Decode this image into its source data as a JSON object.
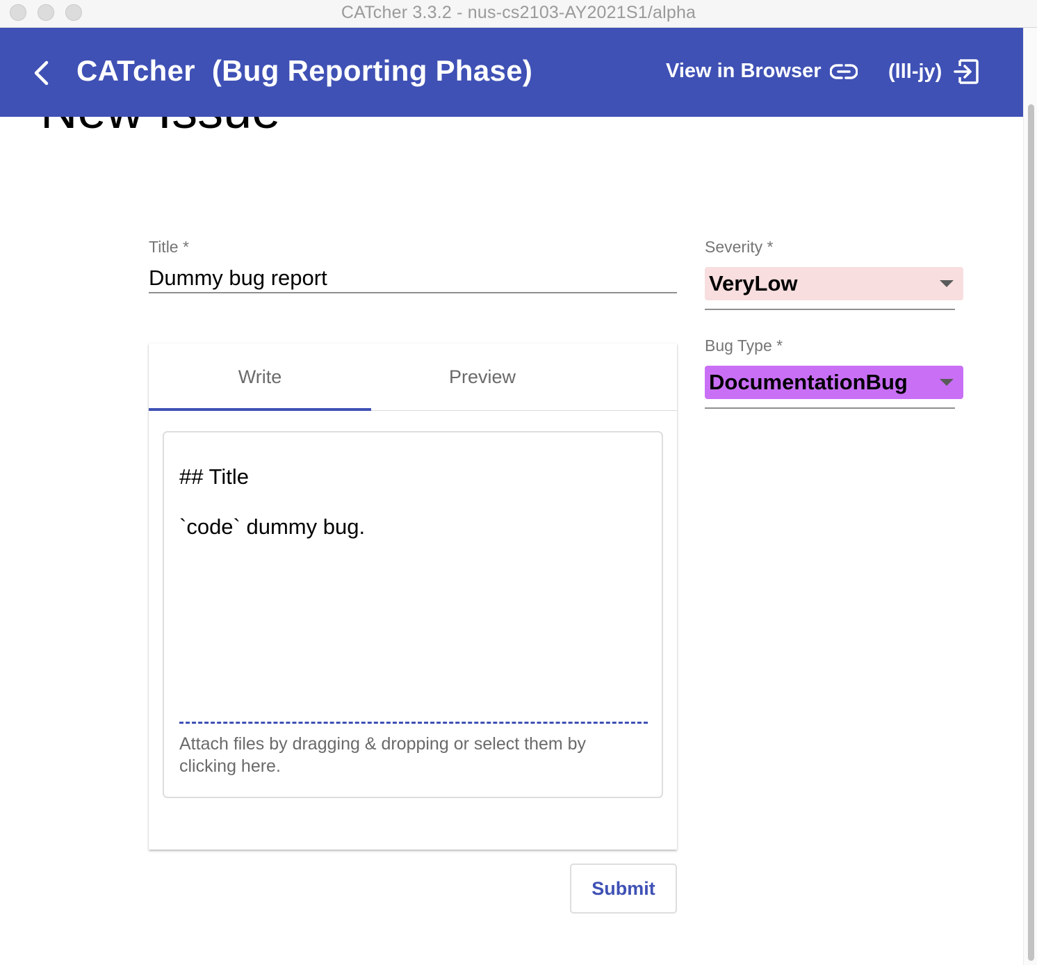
{
  "window": {
    "title": "CATcher 3.3.2 - nus-cs2103-AY2021S1/alpha"
  },
  "header": {
    "app_title": "CATcher  (Bug Reporting Phase)",
    "view_in_browser": "View in Browser",
    "user": "(lll-jy)",
    "bg_color": "#3f51b5"
  },
  "page": {
    "heading": "New Issue"
  },
  "form": {
    "title_label": "Title *",
    "title_value": "Dummy bug report",
    "severity_label": "Severity *",
    "severity_value": "VeryLow",
    "severity_color": "#f8dedf",
    "bug_type_label": "Bug Type *",
    "bug_type_value": "DocumentationBug",
    "bug_type_color": "#c96ff6"
  },
  "editor": {
    "tabs": [
      {
        "label": "Write"
      },
      {
        "label": "Preview"
      }
    ],
    "active_tab": "Write",
    "lines": [
      "## Title",
      "`code` dummy bug."
    ],
    "attach_hint": "Attach files by dragging & dropping or select them by clicking here."
  },
  "actions": {
    "submit_label": "Submit"
  },
  "icons": {
    "back": "chevron-left-icon",
    "view_browser": "link-icon",
    "logout": "logout-icon"
  }
}
